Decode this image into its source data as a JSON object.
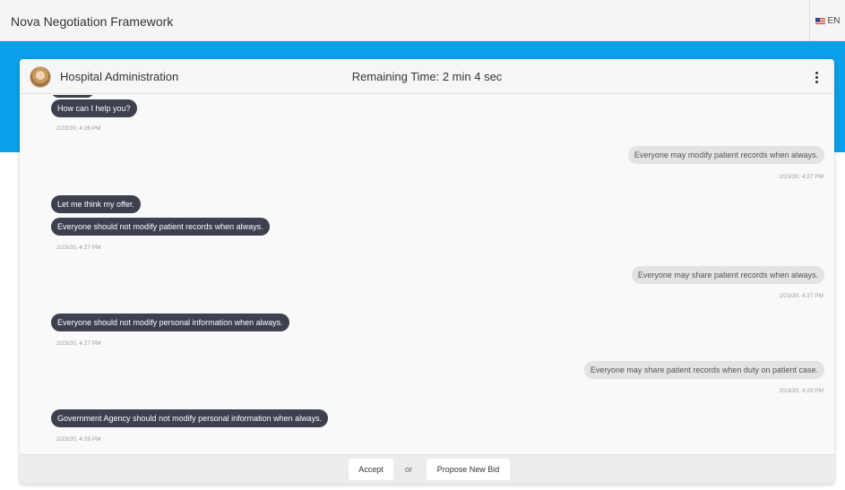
{
  "app": {
    "title": "Nova Negotiation Framework",
    "language": "EN",
    "flag_icon": "us-flag-icon"
  },
  "colors": {
    "band": "#0a9fe8",
    "them_bubble": "#3e404f",
    "me_bubble": "#e3e3e3"
  },
  "header": {
    "counterpart": "Hospital Administration",
    "timer": "Remaining Time: 2 min  4 sec",
    "menu_icon": "more-vertical-icon"
  },
  "messages": [
    {
      "from": "them",
      "text": "How can I help you?"
    },
    {
      "stamp": "2/23/20, 4:26 PM"
    },
    {
      "from": "me",
      "text": "Everyone may modify patient records when always."
    },
    {
      "stamp": "2/23/20, 4:27 PM"
    },
    {
      "from": "them",
      "text": "Let me think my offer."
    },
    {
      "from": "them",
      "text": "Everyone should not modify patient records when always."
    },
    {
      "stamp": "2/23/20, 4:27 PM"
    },
    {
      "from": "me",
      "text": "Everyone may share patient records when always."
    },
    {
      "stamp": "2/23/20, 4:27 PM"
    },
    {
      "from": "them",
      "text": "Everyone should not modify personal information when always."
    },
    {
      "stamp": "2/23/20, 4:27 PM"
    },
    {
      "from": "me",
      "text": "Everyone may share patient records when duty on patient case."
    },
    {
      "stamp": "2/23/20, 4:29 PM"
    },
    {
      "from": "them",
      "text": "Government Agency should not modify personal information when always."
    },
    {
      "stamp": "2/23/20, 4:29 PM"
    }
  ],
  "footer": {
    "accept": "Accept",
    "or": "or",
    "propose": "Propose New Bid"
  }
}
